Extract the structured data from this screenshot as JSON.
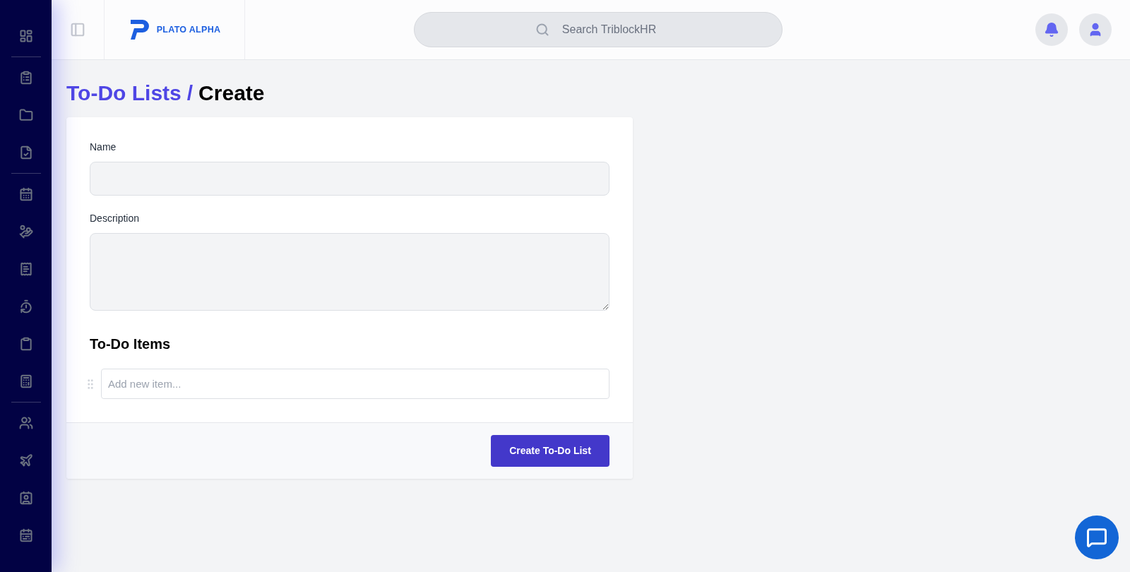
{
  "header": {
    "logo_text": "PLATO ALPHA",
    "search": {
      "placeholder": "Search TriblockHR"
    }
  },
  "breadcrumb": {
    "parent": "To-Do Lists",
    "separator": "/",
    "current": "Create"
  },
  "form": {
    "fields": [
      {
        "label": "Name",
        "kind": "text"
      },
      {
        "label": "Description",
        "kind": "textarea"
      }
    ],
    "items_section": {
      "title": "To-Do Items",
      "new_item": {
        "placeholder": "Add new item..."
      }
    },
    "submit_button": "Create To-Do List"
  }
}
